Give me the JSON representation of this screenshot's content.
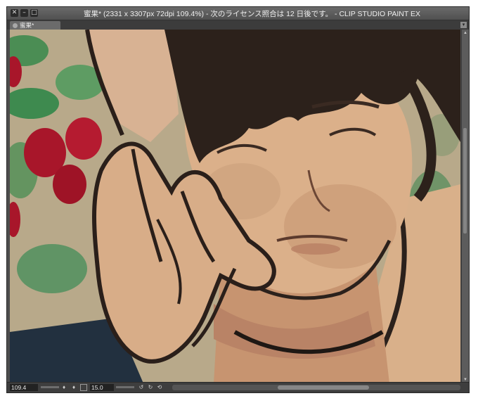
{
  "window": {
    "title": "蜜果* (2331 x 3307px 72dpi 109.4%)  - 次のライセンス照合は 12 日後です。 - CLIP STUDIO PAINT EX",
    "buttons": {
      "close": "✕",
      "minimize": "–",
      "maximize": "□"
    }
  },
  "tabs": [
    {
      "label": "蜜果*"
    }
  ],
  "status_bar": {
    "zoom": "109.4",
    "rotation_angle": "15.0"
  },
  "colors": {
    "titlebar": "#555555",
    "canvas_background": "#b9a889",
    "skin": "#d7a57f",
    "hair": "#2c211b",
    "berries": "#a8162a",
    "leaves": "#3e8a4f"
  },
  "icons": [
    "tab-close-icon",
    "tab-scroll-icon",
    "navigator-icon",
    "lock-icon",
    "flip-icon",
    "rotate-left-icon",
    "rotate-right-icon",
    "reset-rotation-icon"
  ]
}
